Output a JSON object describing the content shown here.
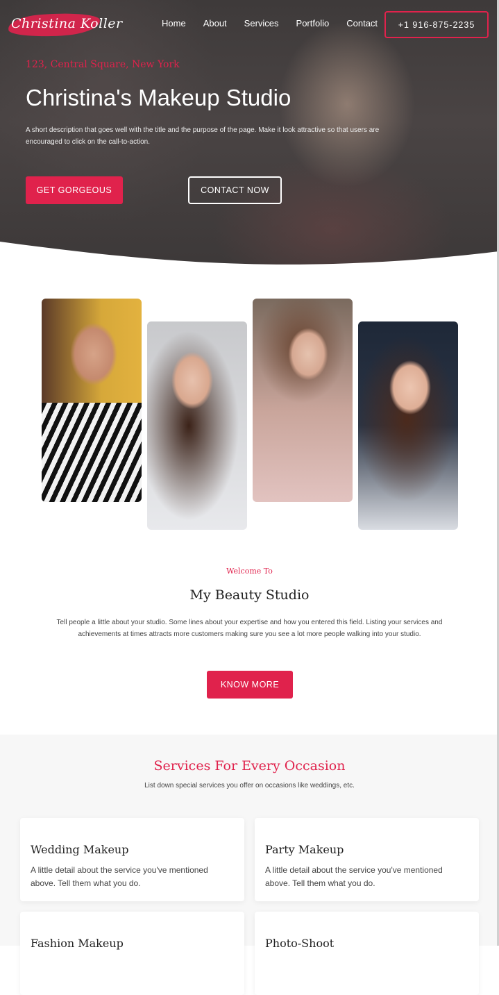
{
  "header": {
    "logo_text": "Christina Koller",
    "nav": [
      "Home",
      "About",
      "Services",
      "Portfolio",
      "Contact"
    ],
    "phone": "+1 916-875-2235"
  },
  "hero": {
    "address": "123, Central Square, New York",
    "title": "Christina's Makeup Studio",
    "description": "A short description that goes well with the title and the purpose of the page. Make it look attractive so that users are encouraged to click on the call-to-action.",
    "primary_button": "GET GORGEOUS",
    "secondary_button": "CONTACT NOW"
  },
  "welcome": {
    "small_heading": "Welcome To",
    "title": "My Beauty Studio",
    "description": "Tell people a little about your studio. Some lines about your expertise and how you entered this field. Listing your services and achievements at times attracts more customers making sure you see a lot more people walking into your studio.",
    "button": "KNOW MORE"
  },
  "services": {
    "title": "Services For Every Occasion",
    "subtitle": "List down special services you offer on occasions like weddings, etc.",
    "cards": [
      {
        "title": "Wedding Makeup",
        "description": "A little detail about the service you've mentioned above. Tell them what you do."
      },
      {
        "title": "Party Makeup",
        "description": "A little detail about the service you've mentioned above. Tell them what you do."
      },
      {
        "title": "Fashion Makeup",
        "description": ""
      },
      {
        "title": "Photo-Shoot",
        "description": ""
      }
    ]
  },
  "colors": {
    "accent": "#e0224c",
    "hero_overlay": "#3e3a3a",
    "section_bg": "#f7f7f7"
  }
}
